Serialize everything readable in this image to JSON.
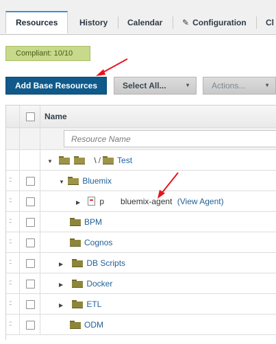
{
  "tabs": {
    "resources": "Resources",
    "history": "History",
    "calendar": "Calendar",
    "configuration": "Configuration",
    "overflow": "Cl"
  },
  "compliance": {
    "label": "Compliant: 10/10"
  },
  "toolbar": {
    "add_base": "Add Base Resources",
    "select_all": "Select All...",
    "actions": "Actions..."
  },
  "grid": {
    "name_header": "Name",
    "filter_placeholder": "Resource Name",
    "path": {
      "prefix": "\\",
      "sep": "/",
      "leaf": "Test"
    },
    "rows": [
      {
        "label": "Bluemix"
      },
      {
        "label_prefix": "p",
        "label": "bluemix-agent",
        "suffix": "(View Agent)"
      },
      {
        "label": "BPM"
      },
      {
        "label": "Cognos"
      },
      {
        "label": "DB Scripts"
      },
      {
        "label": "Docker"
      },
      {
        "label": "ETL"
      },
      {
        "label": "ODM"
      }
    ]
  },
  "colors": {
    "primary_button": "#0f5a8a",
    "compliance_badge": "#c7d98a",
    "tab_accent": "#3d8ed4",
    "link": "#1f5f96",
    "annotation_arrow": "#e8141b"
  }
}
